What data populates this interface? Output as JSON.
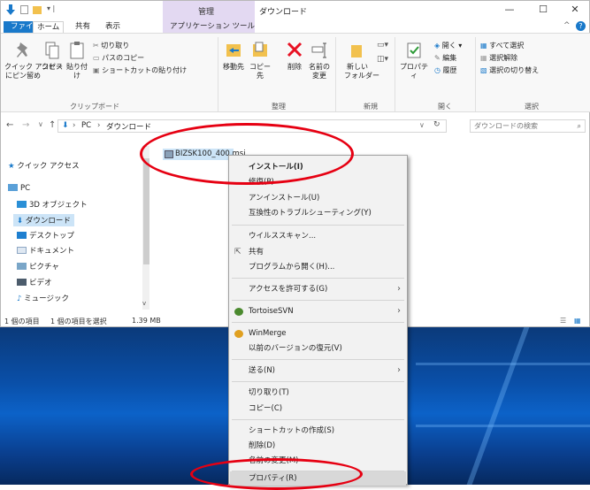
{
  "window": {
    "contextual_group": "管理",
    "title": "ダウンロード"
  },
  "ribbon_tabs": [
    "ファイル",
    "ホーム",
    "共有",
    "表示",
    "アプリケーション ツール"
  ],
  "ribbon": {
    "pin": "クイック アクセス\nにピン留め",
    "copy": "コピー",
    "paste": "貼り付け",
    "cut": "切り取り",
    "copy_path": "パスのコピー",
    "paste_shortcut": "ショートカットの貼り付け",
    "clipboard_label": "クリップボード",
    "move_to": "移動先",
    "copy_to": "コピー先",
    "delete": "削除",
    "rename": "名前の\n変更",
    "organize_label": "整理",
    "new_folder": "新しい\nフォルダー",
    "new_label": "新規",
    "properties": "プロパティ",
    "open": "開く",
    "edit": "編集",
    "history": "履歴",
    "open_label": "開く",
    "select_all": "すべて選択",
    "select_none": "選択解除",
    "invert_selection": "選択の切り替え",
    "select_label": "選択"
  },
  "address": {
    "pc": "PC",
    "folder": "ダウンロード",
    "search_placeholder": "ダウンロードの検索"
  },
  "nav": {
    "quick_access": "クイック アクセス",
    "pc": "PC",
    "items": [
      "3D オブジェクト",
      "ダウンロード",
      "デスクトップ",
      "ドキュメント",
      "ピクチャ",
      "ビデオ",
      "ミュージック"
    ]
  },
  "file": {
    "name": "BIZSK100_400.msi"
  },
  "status": {
    "count": "1 個の項目",
    "selected": "1 個の項目を選択",
    "size": "1.39 MB"
  },
  "context_menu": [
    "インストール(I)",
    "修復(P)",
    "アンインストール(U)",
    "互換性のトラブルシューティング(Y)",
    "ウイルススキャン...",
    "共有",
    "プログラムから開く(H)...",
    "アクセスを許可する(G)",
    "TortoiseSVN",
    "WinMerge",
    "以前のバージョンの復元(V)",
    "送る(N)",
    "切り取り(T)",
    "コピー(C)",
    "ショートカットの作成(S)",
    "削除(D)",
    "名前の変更(M)",
    "プロパティ(R)"
  ],
  "colors": {
    "accent": "#1979ca",
    "annotation": "#e60012",
    "selection": "#cce4f7",
    "context_tab": "#e3d9f2"
  }
}
